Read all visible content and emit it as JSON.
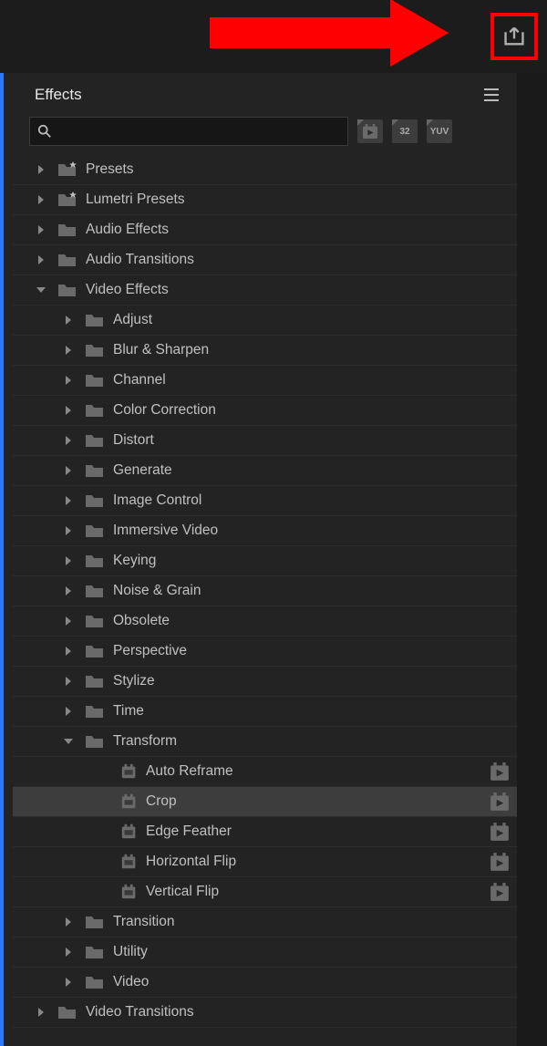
{
  "top": {
    "export_tooltip": "Quick Export"
  },
  "panel": {
    "title": "Effects",
    "search_value": "",
    "search_placeholder": "",
    "filters": [
      "fx",
      "32",
      "YUV"
    ]
  },
  "tree": [
    {
      "indent": 0,
      "disclosure": "right",
      "icon": "folder-star",
      "label": "Presets"
    },
    {
      "indent": 0,
      "disclosure": "right",
      "icon": "folder-star",
      "label": "Lumetri Presets"
    },
    {
      "indent": 0,
      "disclosure": "right",
      "icon": "folder",
      "label": "Audio Effects"
    },
    {
      "indent": 0,
      "disclosure": "right",
      "icon": "folder",
      "label": "Audio Transitions"
    },
    {
      "indent": 0,
      "disclosure": "down",
      "icon": "folder",
      "label": "Video Effects"
    },
    {
      "indent": 1,
      "disclosure": "right",
      "icon": "folder",
      "label": "Adjust"
    },
    {
      "indent": 1,
      "disclosure": "right",
      "icon": "folder",
      "label": "Blur & Sharpen"
    },
    {
      "indent": 1,
      "disclosure": "right",
      "icon": "folder",
      "label": "Channel"
    },
    {
      "indent": 1,
      "disclosure": "right",
      "icon": "folder",
      "label": "Color Correction"
    },
    {
      "indent": 1,
      "disclosure": "right",
      "icon": "folder",
      "label": "Distort"
    },
    {
      "indent": 1,
      "disclosure": "right",
      "icon": "folder",
      "label": "Generate"
    },
    {
      "indent": 1,
      "disclosure": "right",
      "icon": "folder",
      "label": "Image Control"
    },
    {
      "indent": 1,
      "disclosure": "right",
      "icon": "folder",
      "label": "Immersive Video"
    },
    {
      "indent": 1,
      "disclosure": "right",
      "icon": "folder",
      "label": "Keying"
    },
    {
      "indent": 1,
      "disclosure": "right",
      "icon": "folder",
      "label": "Noise & Grain"
    },
    {
      "indent": 1,
      "disclosure": "right",
      "icon": "folder",
      "label": "Obsolete"
    },
    {
      "indent": 1,
      "disclosure": "right",
      "icon": "folder",
      "label": "Perspective"
    },
    {
      "indent": 1,
      "disclosure": "right",
      "icon": "folder",
      "label": "Stylize"
    },
    {
      "indent": 1,
      "disclosure": "right",
      "icon": "folder",
      "label": "Time"
    },
    {
      "indent": 1,
      "disclosure": "down",
      "icon": "folder",
      "label": "Transform"
    },
    {
      "indent": 3,
      "disclosure": "none",
      "icon": "effect",
      "label": "Auto Reframe",
      "trailing": "accel"
    },
    {
      "indent": 3,
      "disclosure": "none",
      "icon": "effect",
      "label": "Crop",
      "trailing": "accel",
      "selected": true
    },
    {
      "indent": 3,
      "disclosure": "none",
      "icon": "effect",
      "label": "Edge Feather",
      "trailing": "accel"
    },
    {
      "indent": 3,
      "disclosure": "none",
      "icon": "effect",
      "label": "Horizontal Flip",
      "trailing": "accel"
    },
    {
      "indent": 3,
      "disclosure": "none",
      "icon": "effect",
      "label": "Vertical Flip",
      "trailing": "accel"
    },
    {
      "indent": 1,
      "disclosure": "right",
      "icon": "folder",
      "label": "Transition"
    },
    {
      "indent": 1,
      "disclosure": "right",
      "icon": "folder",
      "label": "Utility"
    },
    {
      "indent": 1,
      "disclosure": "right",
      "icon": "folder",
      "label": "Video"
    },
    {
      "indent": 0,
      "disclosure": "right",
      "icon": "folder",
      "label": "Video Transitions"
    }
  ]
}
